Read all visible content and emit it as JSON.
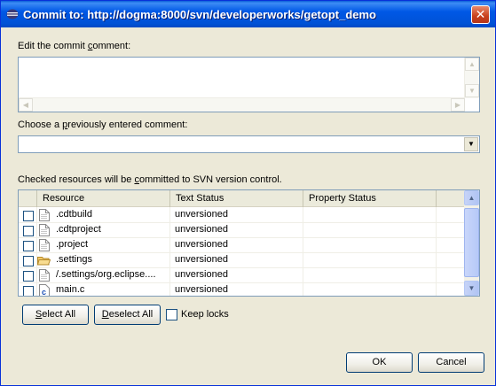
{
  "window": {
    "title": "Commit to: http://dogma:8000/svn/developerworks/getopt_demo",
    "close_symbol": "✕"
  },
  "comment": {
    "label_pre": "Edit the commit ",
    "label_u": "c",
    "label_post": "omment:",
    "value": ""
  },
  "previous": {
    "label_pre": "Choose a ",
    "label_u": "p",
    "label_post": "reviously entered comment:",
    "selected": ""
  },
  "resources": {
    "label_pre": "Checked resources will be ",
    "label_u": "c",
    "label_post": "ommitted to SVN version control.",
    "columns": [
      "Resource",
      "Text Status",
      "Property Status"
    ],
    "rows": [
      {
        "name": ".cdtbuild",
        "icon": "file-icon",
        "text_status": "unversioned",
        "property_status": "",
        "checked": false
      },
      {
        "name": ".cdtproject",
        "icon": "file-icon",
        "text_status": "unversioned",
        "property_status": "",
        "checked": false
      },
      {
        "name": ".project",
        "icon": "file-icon",
        "text_status": "unversioned",
        "property_status": "",
        "checked": false
      },
      {
        "name": ".settings",
        "icon": "folder-icon",
        "text_status": "unversioned",
        "property_status": "",
        "checked": false
      },
      {
        "name": "/.settings/org.eclipse....",
        "icon": "file-icon",
        "text_status": "unversioned",
        "property_status": "",
        "checked": false
      },
      {
        "name": "main.c",
        "icon": "c-file-icon",
        "text_status": "unversioned",
        "property_status": "",
        "checked": false
      }
    ]
  },
  "buttons": {
    "select_all_u": "S",
    "select_all_rest": "elect All",
    "deselect_all_pre": "",
    "deselect_all_u": "D",
    "deselect_all_rest": "eselect All",
    "keep_locks": "Keep locks",
    "ok": "OK",
    "cancel": "Cancel"
  },
  "colors": {
    "titlebar": "#0054e3",
    "dialog_bg": "#ece9d8",
    "border": "#7f9db9"
  }
}
